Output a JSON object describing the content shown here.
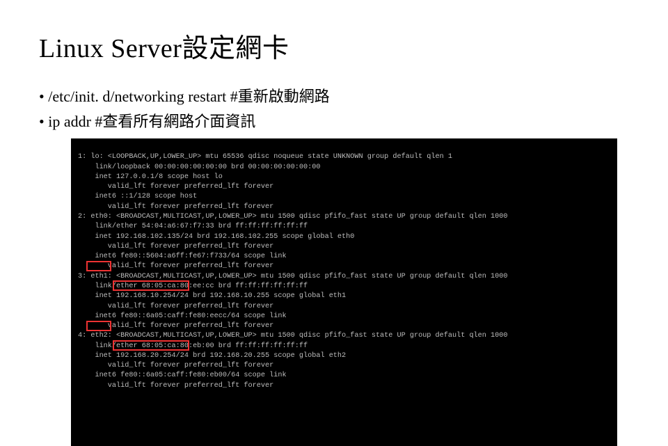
{
  "title": "Linux Server設定網卡",
  "bullets": {
    "b1": "• /etc/init. d/networking restart  #重新啟動網路",
    "b2": "• ip addr  #查看所有網路介面資訊"
  },
  "term": {
    "l01": "1: lo: <LOOPBACK,UP,LOWER_UP> mtu 65536 qdisc noqueue state UNKNOWN group default qlen 1",
    "l02": "    link/loopback 00:00:00:00:00:00 brd 00:00:00:00:00:00",
    "l03": "    inet 127.0.0.1/8 scope host lo",
    "l04": "       valid_lft forever preferred_lft forever",
    "l05": "    inet6 ::1/128 scope host",
    "l06": "       valid_lft forever preferred_lft forever",
    "l07": "2: eth0: <BROADCAST,MULTICAST,UP,LOWER_UP> mtu 1500 qdisc pfifo_fast state UP group default qlen 1000",
    "l08": "    link/ether 54:04:a6:67:f7:33 brd ff:ff:ff:ff:ff:ff",
    "l09": "    inet 192.168.102.135/24 brd 192.168.102.255 scope global eth0",
    "l10": "       valid_lft forever preferred_lft forever",
    "l11": "    inet6 fe80::5604:a6ff:fe67:f733/64 scope link",
    "l12": "       valid_lft forever preferred_lft forever",
    "l13": "3: eth1: <BROADCAST,MULTICAST,UP,LOWER_UP> mtu 1500 qdisc pfifo_fast state UP group default qlen 1000",
    "l14": "    link/ether 68:05:ca:80:ee:cc brd ff:ff:ff:ff:ff:ff",
    "l15": "    inet 192.168.10.254/24 brd 192.168.10.255 scope global eth1",
    "l16": "       valid_lft forever preferred_lft forever",
    "l17": "    inet6 fe80::6a05:caff:fe80:eecc/64 scope link",
    "l18": "       valid_lft forever preferred_lft forever",
    "l19": "4: eth2: <BROADCAST,MULTICAST,UP,LOWER_UP> mtu 1500 qdisc pfifo_fast state UP group default qlen 1000",
    "l20": "    link/ether 68:05:ca:80:eb:00 brd ff:ff:ff:ff:ff:ff",
    "l21": "    inet 192.168.20.254/24 brd 192.168.20.255 scope global eth2",
    "l22": "       valid_lft forever preferred_lft forever",
    "l23": "    inet6 fe80::6a05:caff:fe80:eb00/64 scope link",
    "l24": "       valid_lft forever preferred_lft forever"
  }
}
